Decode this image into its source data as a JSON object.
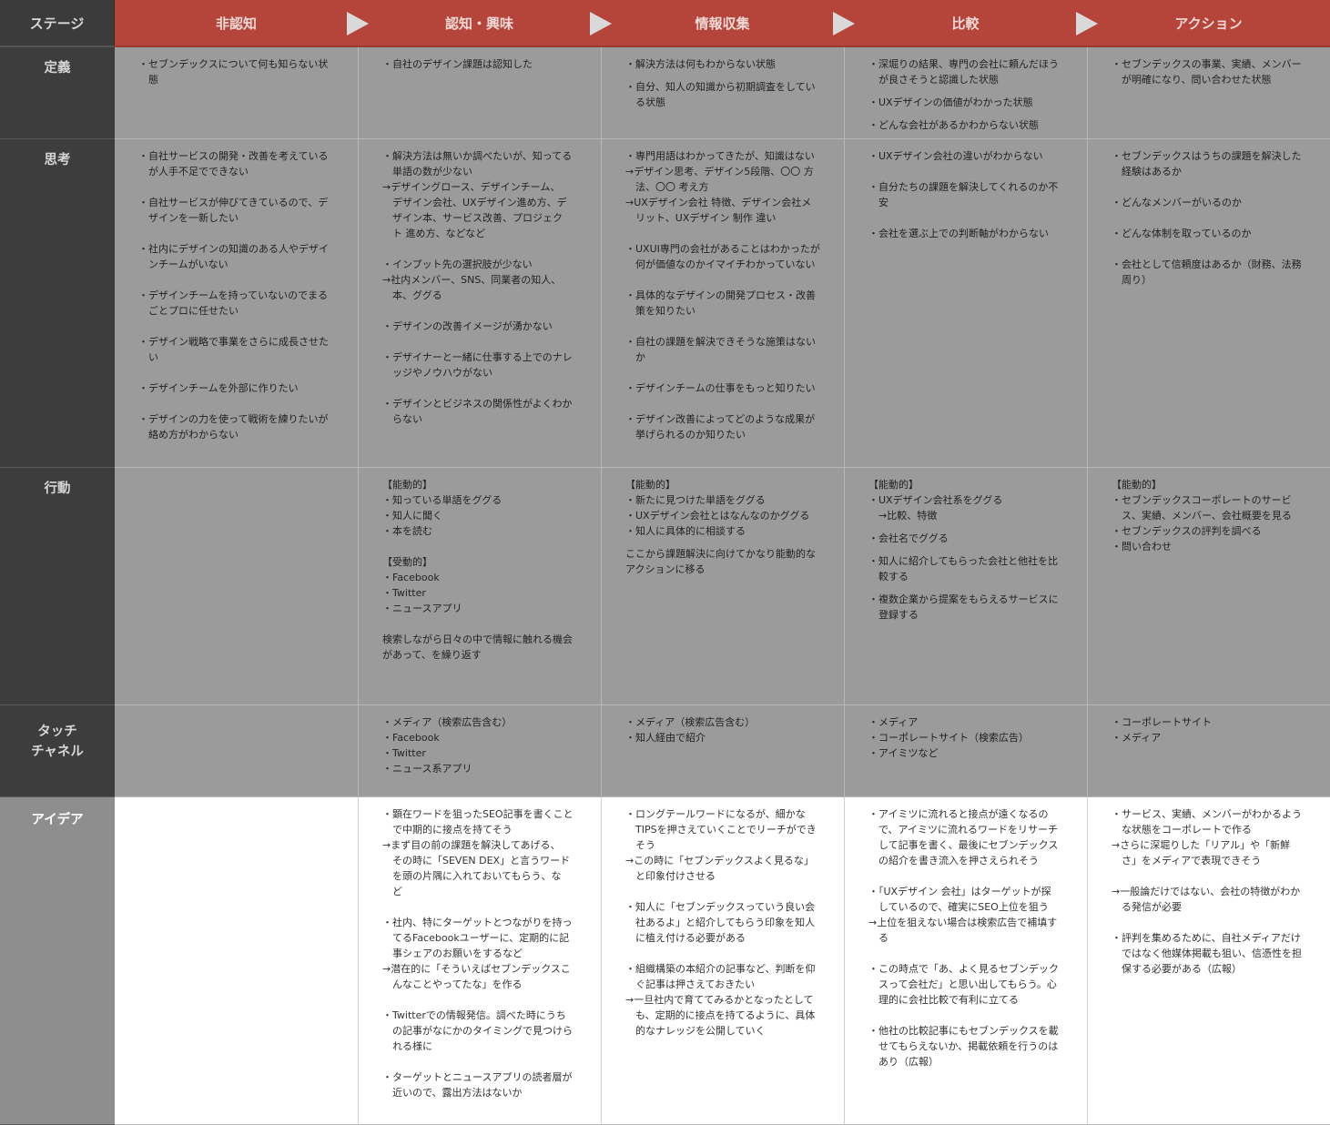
{
  "header": {
    "corner": "ステージ",
    "stages": [
      "非認知",
      "認知・興味",
      "情報収集",
      "比較",
      "アクション"
    ]
  },
  "rows": {
    "definition": {
      "label": "定義",
      "cells": [
        [
          "・セブンデックスについて何も知らない状\n　態"
        ],
        [
          "・自社のデザイン課題は認知した"
        ],
        [
          "・解決方法は何もわからない状態",
          "・自分、知人の知識から初期調査をしてい\n　る状態"
        ],
        [
          "・深堀りの結果、専門の会社に頼んだほう\n　が良さそうと認識した状態",
          "・UXデザインの価値がわかった状態",
          "・どんな会社があるかわからない状態"
        ],
        [
          "・セブンデックスの事業、実績、メンバー\n　が明確になり、問い合わせた状態"
        ]
      ]
    },
    "thinking": {
      "label": "思考",
      "cells": [
        [
          "・自社サービスの開発・改善を考えている\n　が人手不足でできない",
          "・自社サービスが伸びてきているので、デ\n　ザインを一新したい",
          "・社内にデザインの知識のある人やデザイ\n　ンチームがいない",
          "・デザインチームを持っていないのでまる\n　ごとプロに任せたい",
          "・デザイン戦略で事業をさらに成長させた\n　い",
          "・デザインチームを外部に作りたい",
          "・デザインの力を使って戦術を練りたいが\n　絡め方がわからない"
        ],
        [
          "・解決方法は無いか調べたいが、知ってる\n　単語の数が少ない\n→デザイングロース、デザインチーム、\n　デザイン会社、UXデザイン進め方、デ\n　ザイン本、サービス改善、プロジェク\n　ト 進め方、などなど",
          "・インプット先の選択肢が少ない\n→社内メンバー、SNS、同業者の知人、\n　本、ググる",
          "・デザインの改善イメージが湧かない",
          "・デザイナーと一緒に仕事する上でのナレ\n　ッジやノウハウがない",
          "・デザインとビジネスの関係性がよくわか\n　らない"
        ],
        [
          "・専門用語はわかってきたが、知識はない\n→デザイン思考、デザイン5段階、〇〇 方\n　法、〇〇 考え方\n→UXデザイン会社 特徴、デザイン会社メ\n　リット、UXデザイン 制作 違い",
          "・UXUI専門の会社があることはわかったが\n　何が価値なのかイマイチわかっていない",
          "・具体的なデザインの開発プロセス・改善\n　策を知りたい",
          "・自社の課題を解決できそうな施策はない\n　か",
          "・デザインチームの仕事をもっと知りたい",
          "・デザイン改善によってどのような成果が\n　挙げられるのか知りたい"
        ],
        [
          "・UXデザイン会社の違いがわからない",
          "・自分たちの課題を解決してくれるのか不\n　安",
          "・会社を選ぶ上での判断軸がわからない"
        ],
        [
          "・セブンデックスはうちの課題を解決した\n　経験はあるか",
          "・どんなメンバーがいるのか",
          "・どんな体制を取っているのか",
          "・会社として信頼度はあるか（財務、法務\n　周り）"
        ]
      ]
    },
    "action": {
      "label": "行動",
      "cells": [
        [],
        [
          "【能動的】\n・知っている単語をググる\n・知人に聞く\n・本を読む",
          "【受動的】\n・Facebook\n・Twitter\n・ニュースアプリ",
          "検索しながら日々の中で情報に触れる機会\nがあって、を繰り返す"
        ],
        [
          "【能動的】\n・新たに見つけた単語をググる\n・UXデザイン会社とはなんなのかググる\n・知人に具体的に相談する",
          "ここから課題解決に向けてかなり能動的な\nアクションに移る"
        ],
        [
          "【能動的】\n・UXデザイン会社系をググる\n　→比較、特徴",
          "・会社名でググる",
          "・知人に紹介してもらった会社と他社を比\n　較する",
          "・複数企業から提案をもらえるサービスに\n　登録する"
        ],
        [
          "【能動的】\n・セブンデックスコーポレートのサービ\n　ス、実績、メンバー、会社概要を見る\n・セブンデックスの評判を調べる\n・問い合わせ"
        ]
      ]
    },
    "touch": {
      "label": "タッチ\nチャネル",
      "cells": [
        [],
        [
          "・メディア（検索広告含む）\n・Facebook\n・Twitter\n・ニュース系アプリ"
        ],
        [
          "・メディア（検索広告含む）\n・知人経由で紹介"
        ],
        [
          "・メディア\n・コーポレートサイト（検索広告）\n・アイミツなど"
        ],
        [
          "・コーポレートサイト\n・メディア"
        ]
      ]
    },
    "idea": {
      "label": "アイデア",
      "cells": [
        [],
        [
          "・顕在ワードを狙ったSEO記事を書くこと\n　で中期的に接点を持てそう\n→まず目の前の課題を解決してあげる、\n　その時に「SEVEN DEX」と言うワード\n　を頭の片隅に入れておいてもらう、な\n　ど",
          "・社内、特にターゲットとつながりを持っ\n　てるFacebookユーザーに、定期的に記\n　事シェアのお願いをするなど\n→潜在的に「そういえばセブンデックスこ\n　んなことやってたな」を作る",
          "・Twitterでの情報発信。調べた時にうち\n　の記事がなにかのタイミングで見つけら\n　れる様に",
          "・ターゲットとニュースアプリの読者層が\n　近いので、露出方法はないか"
        ],
        [
          "・ロングテールワードになるが、細かな\n　TIPSを押さえていくことでリーチができ\n　そう\n→この時に「セブンデックスよく見るな」\n　と印象付けさせる",
          "・知人に「セブンデックスっていう良い会\n　社あるよ」と紹介してもらう印象を知人\n　に植え付ける必要がある",
          "・組織構築の本紹介の記事など、判断を仰\n　ぐ記事は押さえておきたい\n→一旦社内で育ててみるかとなったとして\n　も、定期的に接点を持てるように、具体\n　的なナレッジを公開していく"
        ],
        [
          "・アイミツに流れると接点が遠くなるの\n　で、アイミツに流れるワードをリサーチ\n　して記事を書く、最後にセブンデックス\n　の紹介を書き流入を押さえられそう",
          "・「UXデザイン 会社」はターゲットが探\n　しているので、確実にSEO上位を狙う\n→上位を狙えない場合は検索広告で補填す\n　る",
          "・この時点で「あ、よく見るセブンデック\n　スって会社だ」と思い出してもらう。心\n　理的に会社比較で有利に立てる",
          "・他社の比較記事にもセブンデックスを載\n　せてもらえないか、掲載依頼を行うのは\n　あり（広報）"
        ],
        [
          "・サービス、実績、メンバーがわかるよう\n　な状態をコーポレートで作る\n→さらに深堀りした「リアル」や「新鮮\n　さ」をメディアで表現できそう",
          "→一般論だけではない、会社の特徴がわか\n　る発信が必要",
          "・評判を集めるために、自社メディアだけ\n　ではなく他媒体掲載も狙い、信憑性を担\n　保する必要がある（広報）"
        ]
      ]
    }
  },
  "colors": {
    "header_stage": "#b5453a",
    "header_corner": "#3b3b3b",
    "row_label": "#3d3d3d",
    "cell_gray": "#9b9b9b",
    "idea_bg": "#ffffff",
    "arrow": "#d9d9d9"
  }
}
